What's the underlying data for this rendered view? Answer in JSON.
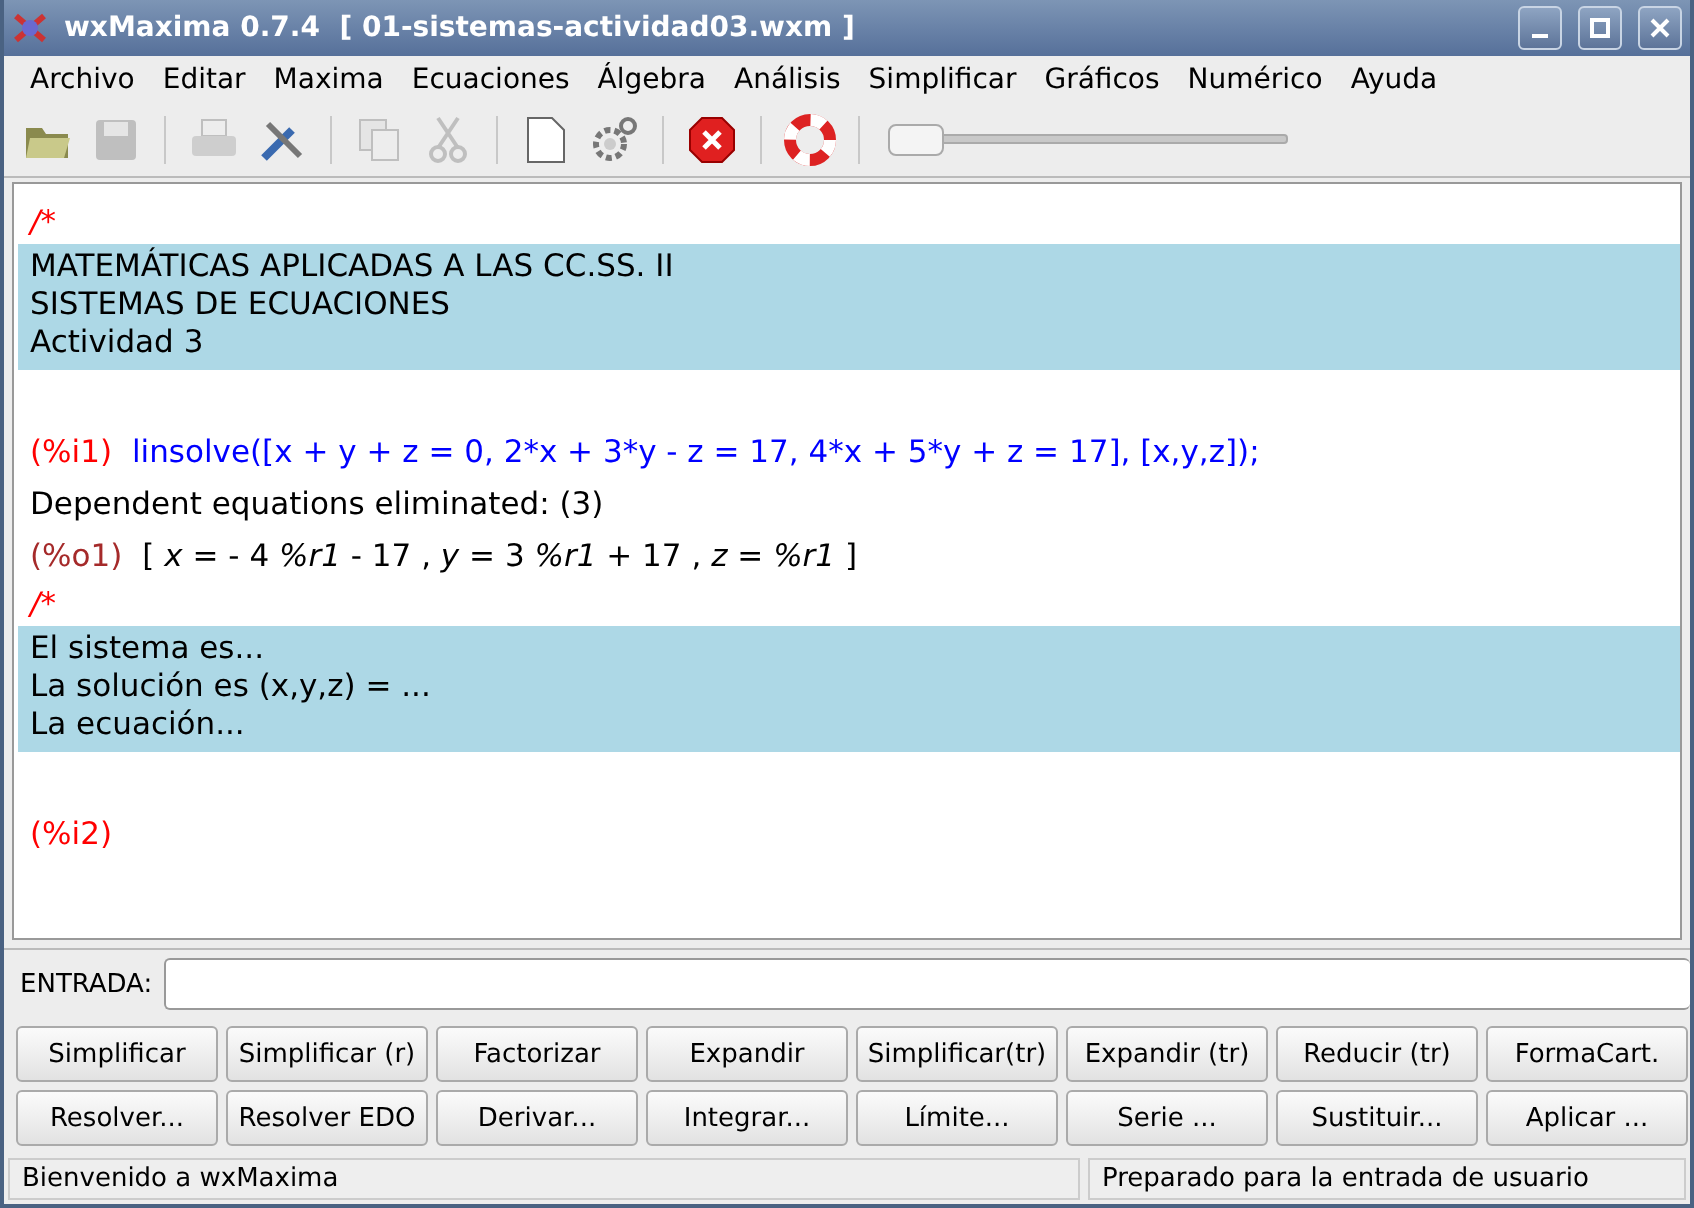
{
  "window": {
    "title": "wxMaxima 0.7.4  [ 01-sistemas-actividad03.wxm ]"
  },
  "menu": [
    "Archivo",
    "Editar",
    "Maxima",
    "Ecuaciones",
    "Álgebra",
    "Análisis",
    "Simplificar",
    "Gráficos",
    "Numérico",
    "Ayuda"
  ],
  "toolbar": [
    {
      "kind": "open",
      "disabled": false
    },
    {
      "kind": "save",
      "disabled": true
    },
    {
      "kind": "sep"
    },
    {
      "kind": "print",
      "disabled": true
    },
    {
      "kind": "tools",
      "disabled": false
    },
    {
      "kind": "sep"
    },
    {
      "kind": "copy",
      "disabled": true
    },
    {
      "kind": "cut",
      "disabled": true
    },
    {
      "kind": "sep"
    },
    {
      "kind": "new",
      "disabled": false
    },
    {
      "kind": "gear",
      "disabled": false
    },
    {
      "kind": "sep"
    },
    {
      "kind": "stop",
      "disabled": false
    },
    {
      "kind": "sep"
    },
    {
      "kind": "help",
      "disabled": false
    },
    {
      "kind": "sep"
    },
    {
      "kind": "slider",
      "level": 0
    }
  ],
  "worksheet": [
    {
      "kind": "marker",
      "text": "/*"
    },
    {
      "kind": "text",
      "lines": [
        "MATEMÁTICAS APLICADAS A LAS CC.SS. II",
        "SISTEMAS DE ECUACIONES",
        "Actividad 3"
      ]
    },
    {
      "kind": "gap"
    },
    {
      "kind": "input",
      "prompt": "(%i1)",
      "code": "linsolve([x + y + z = 0, 2*x + 3*y - z = 17, 4*x + 5*y + z = 17], [x,y,z]);"
    },
    {
      "kind": "message",
      "text": "Dependent equations eliminated:  (3)"
    },
    {
      "kind": "output",
      "prompt": "(%o1)",
      "math": "[ *x* = - 4 *%r1* - 17 , *y* = 3 *%r1* + 17 , *z* = *%r1* ]"
    },
    {
      "kind": "marker",
      "text": "/*"
    },
    {
      "kind": "text",
      "lines": [
        "El sistema es...",
        "La solución es (x,y,z) = ...",
        "La ecuación..."
      ]
    },
    {
      "kind": "gap"
    },
    {
      "kind": "input",
      "prompt": "(%i2)"
    }
  ],
  "entry": {
    "label": "ENTRADA:"
  },
  "buttons": [
    [
      "Simplificar",
      "Simplificar (r)",
      "Factorizar",
      "Expandir",
      "Simplificar(tr)",
      "Expandir (tr)",
      "Reducir (tr)",
      "FormaCart."
    ],
    [
      "Resolver...",
      "Resolver EDO",
      "Derivar...",
      "Integrar...",
      "Límite...",
      "Serie ...",
      "Sustituir...",
      "Aplicar ..."
    ]
  ],
  "status_bar": [
    "Bienvenido a wxMaxima",
    "Preparado para la entrada de usuario"
  ]
}
